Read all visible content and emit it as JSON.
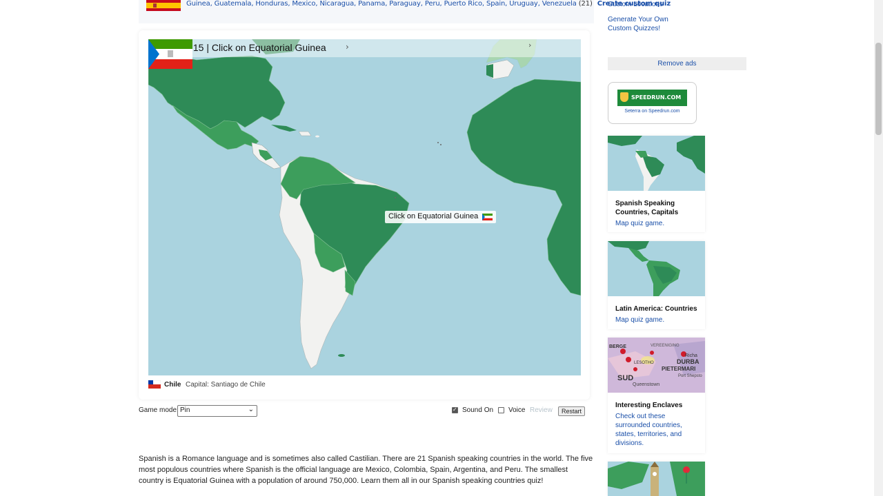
{
  "top_strip": {
    "countries_text": "Guinea, Guatemala, Honduras, Mexico, Nicaragua, Panama, Paraguay, Peru, Puerto Rico, Spain, Uruguay, Venezuela",
    "count": "(21)",
    "create_link": "Create custom quiz"
  },
  "game": {
    "status": "100% | 0:15 | Click on Equatorial Guinea",
    "tooltip": "Click on Equatorial Guinea",
    "last_country": "Chile",
    "last_capital": "Capital: Santiago de Chile"
  },
  "controls": {
    "game_mode_label": "Game mode:",
    "game_mode_value": "Pin",
    "sound_label": "Sound On",
    "sound_on": true,
    "voice_label": "Voice",
    "voice_on": false,
    "review_label": "Review",
    "restart_label": "Restart"
  },
  "description": "Spanish is a Romance language and is sometimes also called Castilian. There are 21 Spanish speaking countries in the world. The five most populous countries where Spanish is the official language are Mexico, Colombia, Spain, Argentina, and Peru. The smallest country is Equatorial Guinea with a population of around 750,000. Learn them all in our Spanish speaking countries quiz!",
  "sidebar": {
    "custom_locations": "Custom Locations",
    "generate_line1": "Generate Your Own",
    "generate_line2": "Custom Quizzes!",
    "remove_ads": "Remove ads",
    "speedrun_logo": "SPEEDRUN.COM",
    "speedrun_caption": "Seterra on Speedrun.com",
    "tiles": [
      {
        "title_line1": "Spanish Speaking",
        "title_line2": "Countries, Capitals",
        "sub_line1": "Map quiz game."
      },
      {
        "title_line1": "Latin America: Countries",
        "sub_line1": "Map quiz game."
      },
      {
        "title_line1": "Interesting Enclaves",
        "sub_line1": "Check out these",
        "sub_line2": "surrounded countries,",
        "sub_line3": "states, territories, and",
        "sub_line4": "divisions."
      }
    ],
    "enclave_thumb_labels": [
      "BERGE",
      "Richa",
      "DURBA",
      "PIETERMARI",
      "Port Shepsto",
      "LESOTHO",
      "SUD",
      "Queenstown",
      "VEREENIGING"
    ]
  },
  "colors": {
    "ocean": "#aad3df",
    "land_dark": "#2e8b57",
    "land_mid": "#3d9e5c",
    "land_light": "#f2f2f0",
    "link": "#1a4fa8"
  }
}
